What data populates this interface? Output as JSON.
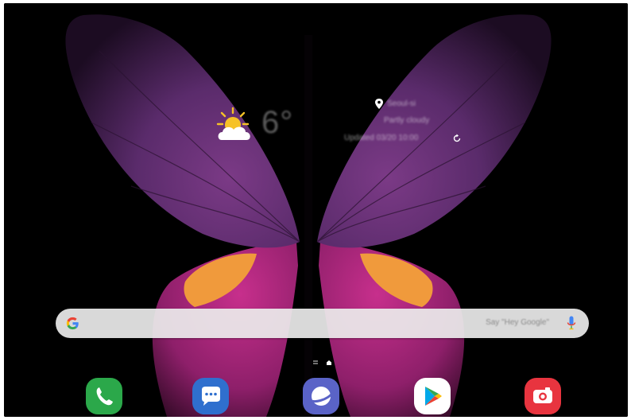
{
  "home_screen": {
    "weather": {
      "temperature": "6°",
      "icon": "partly-sunny-icon"
    },
    "location_widget": {
      "place": "Seoul-si",
      "updated": "Partly cloudy",
      "time": "Updated 03/20 10:00"
    },
    "search_bar": {
      "provider_icon": "google-g-icon",
      "hint": "Say \"Hey Google\"",
      "mic_icon": "microphone-icon"
    },
    "page_indicator": {
      "pages": 2,
      "current": 2
    },
    "dock": [
      {
        "name": "Phone",
        "icon": "phone-icon",
        "color": "#2BA84A"
      },
      {
        "name": "Messages",
        "icon": "chat-bubble-icon",
        "color": "#2F6FCE"
      },
      {
        "name": "Internet",
        "icon": "planet-icon",
        "color": "#5A63C7"
      },
      {
        "name": "Play Store",
        "icon": "play-store-icon",
        "color": "#FFFFFF"
      },
      {
        "name": "Camera",
        "icon": "camera-icon",
        "color": "#E8343F"
      }
    ]
  },
  "colors": {
    "wallpaper_bg": "#000000",
    "wing_purple": "#5B2C6F",
    "wing_magenta": "#B0267E",
    "wing_orange": "#F29A3B"
  }
}
